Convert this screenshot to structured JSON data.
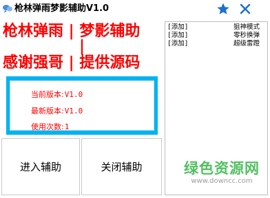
{
  "window": {
    "title": "枪林弹雨梦影辅助V1.0",
    "pin_icon": "star-icon",
    "close_icon": "close-icon",
    "accent": "#1e6fd6"
  },
  "headline": {
    "line1": "枪林弹雨 | 梦影辅助",
    "separator": "|",
    "line2": "感谢强哥 | 提供源码",
    "color": "#ff0000"
  },
  "info": {
    "border_color": "#00b4f0",
    "current_version_label": "当前版本:",
    "current_version": "V1.0",
    "latest_version_label": "最新版本:",
    "latest_version": "V1.0",
    "use_count_label": "使用次数:",
    "use_count": "1"
  },
  "buttons": {
    "enter_label": "进入辅助",
    "close_label": "关闭辅助"
  },
  "log": {
    "rows": [
      {
        "tag": "[添加]",
        "message": "狙神模式"
      },
      {
        "tag": "[添加]",
        "message": "零秒换弹"
      },
      {
        "tag": "[添加]",
        "message": "超级雷蹬"
      }
    ]
  },
  "watermark": {
    "main": "绿色资源网",
    "sub": "www.downcc.com",
    "color": "#34b546"
  }
}
